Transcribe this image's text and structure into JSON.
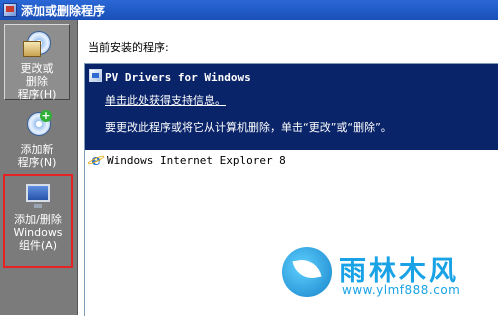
{
  "window": {
    "title": "添加或删除程序"
  },
  "sidebar": {
    "items": [
      {
        "label": "更改或\n删除\n程序(H)"
      },
      {
        "label": "添加新\n程序(N)"
      },
      {
        "label": "添加/删除\nWindows\n组件(A)"
      }
    ]
  },
  "main": {
    "section_title": "当前安装的程序:",
    "programs": [
      {
        "name": "PV Drivers for Windows",
        "support_link": "单击此处获得支持信息。",
        "hint": "要更改此程序或将它从计算机删除，单击“更改”或“删除”。"
      },
      {
        "name": "Windows Internet Explorer 8"
      }
    ]
  },
  "watermark": {
    "title": "雨林木风",
    "url": "www.ylmf888.com"
  },
  "colors": {
    "selection": "#0a246a",
    "sidebar": "#7b7b7b",
    "titlebar": "#1a4fb8",
    "watermark": "#19a3e6",
    "highlight_border": "#e52323"
  }
}
